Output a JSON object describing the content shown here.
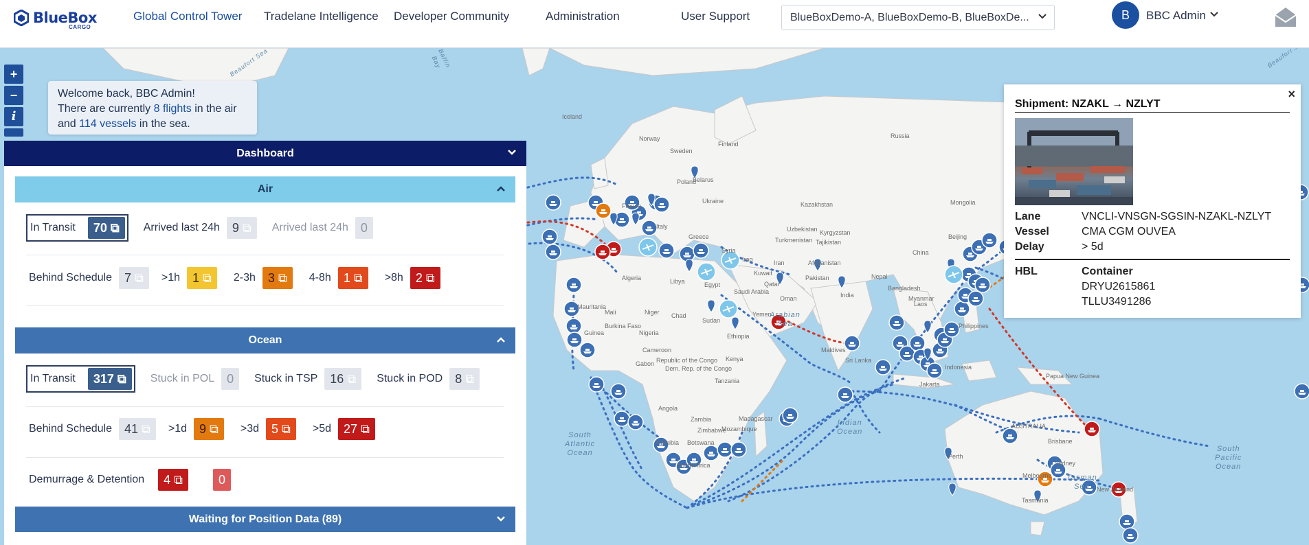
{
  "brand": {
    "name": "BlueBox",
    "sub": "CARGO"
  },
  "nav": {
    "items": [
      "Global Control Tower",
      "Tradelane Intelligence",
      "Developer Community",
      "Administration",
      "User Support"
    ],
    "tenant_value": "BlueBoxDemo-A, BlueBoxDemo-B, BlueBoxDe...",
    "user_initial": "B",
    "user_name": "BBC Admin"
  },
  "map_controls": {
    "zoom_in": "+",
    "zoom_out": "−",
    "info": "i"
  },
  "welcome": {
    "line1": "Welcome back, BBC Admin!",
    "line2_pre": "There are currently ",
    "flights": "8 flights",
    "line2_post": " in the air",
    "line3_pre": "and ",
    "vessels": "114 vessels",
    "line3_post": " in the sea."
  },
  "dashboard": {
    "title": "Dashboard",
    "air": {
      "title": "Air",
      "in_transit_label": "In Transit",
      "in_transit": "70",
      "arrived1_label": "Arrived last 24h",
      "arrived1": "9",
      "arrived2_label": "Arrived last 24h",
      "arrived2": "0",
      "behind_label": "Behind Schedule",
      "behind": "7",
      "b1_label": ">1h",
      "b1": "1",
      "b2_label": "2-3h",
      "b2": "3",
      "b3_label": "4-8h",
      "b3": "1",
      "b4_label": ">8h",
      "b4": "2"
    },
    "ocean": {
      "title": "Ocean",
      "in_transit_label": "In Transit",
      "in_transit": "317",
      "pol_label": "Stuck in POL",
      "pol": "0",
      "tsp_label": "Stuck in TSP",
      "tsp": "16",
      "pod_label": "Stuck in POD",
      "pod": "8",
      "behind_label": "Behind Schedule",
      "behind": "41",
      "b1_label": ">1d",
      "b1": "9",
      "b2_label": ">3d",
      "b2": "5",
      "b3_label": ">5d",
      "b3": "27",
      "dd_label": "Demurrage & Detention",
      "dd1": "4",
      "dd2": "0"
    },
    "waiting": "Waiting for Position Data (89)"
  },
  "map_labels": [
    "Iceland",
    "Norway",
    "Sweden",
    "Finland",
    "Russia",
    "Belarus",
    "Ukraine",
    "Kazakhstan",
    "Mongolia",
    "China",
    "Iran",
    "Iraq",
    "Egypt",
    "Libya",
    "Algeria",
    "Mali",
    "Niger",
    "Chad",
    "Sudan",
    "Nigeria",
    "Ethiopia",
    "Kenya",
    "Tanzania",
    "Angola",
    "Namibia",
    "Botswana",
    "South Africa",
    "Madagascar",
    "India",
    "Pakistan",
    "Afghanistan",
    "Turkmenistan",
    "Uzbekistan",
    "Kyrgyzstan",
    "Tajikistan",
    "Oman",
    "Yemen",
    "Saudi Arabia",
    "Indonesia",
    "Philippines",
    "Bangladesh",
    "Nepal",
    "Myanmar",
    "Laos",
    "Papua New Guinea",
    "AUSTRALIA",
    "Perth",
    "Brisbane",
    "Sydney",
    "Melbourne",
    "New Zealand",
    "Italy",
    "France",
    "Poland",
    "Greece",
    "Syria",
    "Kuwait",
    "Qatar",
    "Zambia",
    "Zimbabwe",
    "Mozambique",
    "Cameroon",
    "Gabon",
    "Beijing",
    "Mauritania",
    "Burkina Faso",
    "Dem. Rep. of the Congo",
    "Republic of the Congo",
    "Guinea",
    "Sri Lanka",
    "Maldives",
    "Jakarta",
    "Tasmania"
  ],
  "ocean_labels": {
    "arabian": "Arabian\nSea",
    "indian": "Indian\nOcean",
    "south_atl": "South\nAtlantic\nOcean",
    "south_pac": "South\nPacific\nOcean",
    "tasman": "Tasman\nSea",
    "beaufort": "Beaufort Sea",
    "baffin": "Baffin\nBay"
  },
  "popup": {
    "title": "Shipment: NZAKL → NZLYT",
    "close": "×",
    "lane_label": "Lane",
    "lane": "VNCLI-VNSGN-SGSIN-NZAKL-NZLYT",
    "vessel_label": "Vessel",
    "vessel": "CMA CGM OUVEA",
    "delay_label": "Delay",
    "delay": "> 5d",
    "hbl_label": "HBL",
    "container_label": "Container",
    "containers": [
      "DRYU2615861",
      "TLLU3491286"
    ]
  },
  "colors": {
    "navy": "#0d1c66",
    "air": "#7ecbea",
    "ocean": "#3e72b0",
    "marker": "#3c6fb3",
    "route": "#3a6fc0",
    "alert_red": "#c11a1a",
    "alert_orange": "#e37a10"
  }
}
